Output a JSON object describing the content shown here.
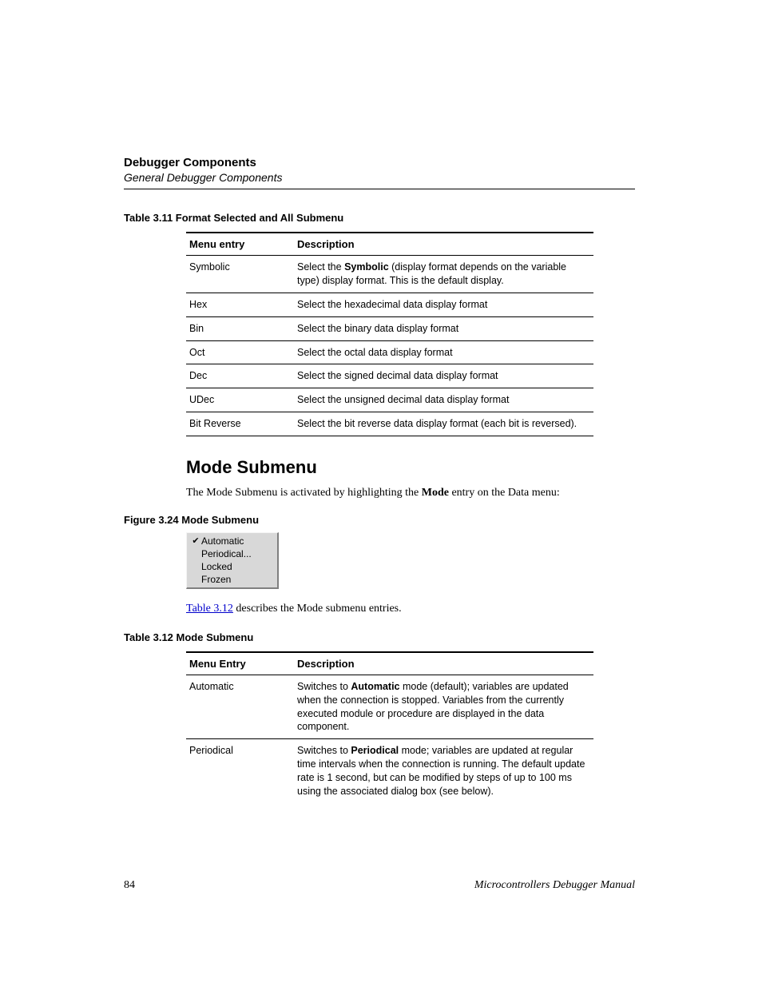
{
  "header": {
    "title": "Debugger Components",
    "subtitle": "General Debugger Components"
  },
  "table311": {
    "caption": "Table 3.11  Format Selected and All Submenu",
    "head": {
      "col1": "Menu entry",
      "col2": "Description"
    },
    "rows": [
      {
        "entry": "Symbolic",
        "desc_pre": "Select the ",
        "desc_bold": "Symbolic",
        "desc_post": " (display format depends on the variable type) display format. This is the default display."
      },
      {
        "entry": "Hex",
        "desc": "Select the hexadecimal data display format"
      },
      {
        "entry": "Bin",
        "desc": "Select the binary data display format"
      },
      {
        "entry": "Oct",
        "desc": "Select the octal data display format"
      },
      {
        "entry": "Dec",
        "desc": "Select the signed decimal data display format"
      },
      {
        "entry": "UDec",
        "desc": "Select the unsigned decimal data display format"
      },
      {
        "entry": "Bit Reverse",
        "desc": "Select the bit reverse data display format (each bit is reversed)."
      }
    ]
  },
  "section": {
    "heading": "Mode Submenu",
    "intro_pre": "The Mode Submenu is activated by highlighting the ",
    "intro_bold": "Mode",
    "intro_post": " entry on the Data menu:"
  },
  "figure324": {
    "caption": "Figure 3.24  Mode Submenu",
    "items": [
      {
        "label": "Automatic",
        "checked": true
      },
      {
        "label": "Periodical...",
        "checked": false
      },
      {
        "label": "Locked",
        "checked": false
      },
      {
        "label": "Frozen",
        "checked": false
      }
    ]
  },
  "ref": {
    "link": "Table 3.12",
    "text": " describes the Mode submenu entries."
  },
  "table312": {
    "caption": "Table 3.12  Mode Submenu",
    "head": {
      "col1": "Menu Entry",
      "col2": "Description"
    },
    "rows": [
      {
        "entry": "Automatic",
        "desc_pre": "Switches to ",
        "desc_bold": "Automatic",
        "desc_post": " mode (default); variables are updated when the connection is stopped. Variables from the currently executed module or procedure are displayed in the data component."
      },
      {
        "entry": "Periodical",
        "desc_pre": "Switches to ",
        "desc_bold": "Periodical",
        "desc_post": " mode; variables are updated at regular time intervals when the connection is running. The default update rate is 1 second, but can be modified by steps of up to 100 ms using the associated dialog box (see below)."
      }
    ]
  },
  "footer": {
    "page": "84",
    "manual": "Microcontrollers Debugger Manual"
  }
}
